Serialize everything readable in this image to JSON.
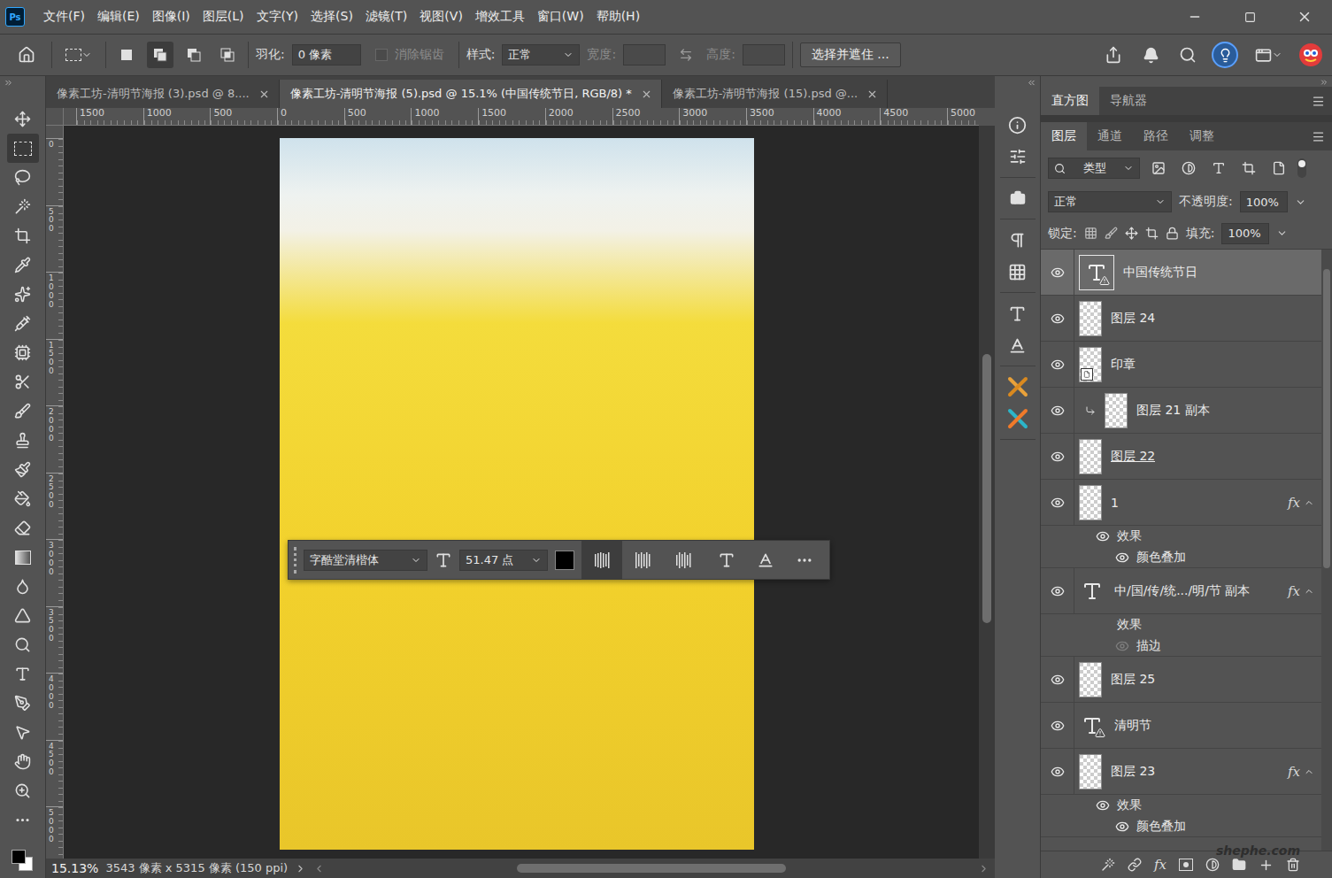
{
  "app": {
    "logo": "Ps"
  },
  "menu": [
    "文件(F)",
    "编辑(E)",
    "图像(I)",
    "图层(L)",
    "文字(Y)",
    "选择(S)",
    "滤镜(T)",
    "视图(V)",
    "增效工具",
    "窗口(W)",
    "帮助(H)"
  ],
  "options_bar": {
    "selection_modes": [
      {
        "selected": false
      },
      {
        "selected": true
      },
      {
        "selected": false
      },
      {
        "selected": false
      }
    ],
    "feather": {
      "label": "羽化:",
      "value": "0 像素"
    },
    "antialias": {
      "label": "消除锯齿",
      "checked": false,
      "disabled": true
    },
    "style": {
      "label": "样式:",
      "value": "正常"
    },
    "width": {
      "label": "宽度:",
      "value": "",
      "disabled": true
    },
    "height": {
      "label": "高度:",
      "value": "",
      "disabled": true
    },
    "mask_button": "选择并遮住 ..."
  },
  "tools": [
    {
      "selected": false
    },
    {
      "selected": true
    },
    {
      "selected": false
    },
    {
      "selected": false
    },
    {
      "selected": false
    },
    {
      "selected": false
    },
    {
      "selected": false
    },
    {
      "selected": false
    },
    {
      "selected": false
    },
    {
      "selected": false
    },
    {
      "selected": false
    },
    {
      "selected": false
    },
    {
      "selected": false
    },
    {
      "selected": false
    },
    {
      "selected": false
    },
    {
      "selected": false
    },
    {
      "selected": false
    },
    {
      "selected": false
    },
    {
      "selected": false
    },
    {
      "selected": false
    },
    {
      "selected": false
    },
    {
      "selected": false
    },
    {
      "selected": false
    },
    {
      "selected": false
    },
    {
      "selected": false
    }
  ],
  "doc_tabs": [
    {
      "label": "像素工坊-清明节海报 (3).psd @ 8....",
      "selected": false
    },
    {
      "label": "像素工坊-清明节海报 (5).psd @ 15.1% (中国传统节日, RGB/8) *",
      "selected": true
    },
    {
      "label": "像素工坊-清明节海报 (15).psd @...",
      "selected": false
    }
  ],
  "rulers": {
    "horizontal": [
      "1500",
      "1000",
      "500",
      "0",
      "500",
      "1000",
      "1500",
      "2000",
      "2500",
      "3000",
      "3500",
      "4000",
      "4500",
      "5000"
    ],
    "vertical": [
      "0",
      "500",
      "1000",
      "1500",
      "2000",
      "2500",
      "3000",
      "3500",
      "4000",
      "4500",
      "5000"
    ]
  },
  "text_toolbar": {
    "font": "字酷堂清楷体",
    "size": "51.47 点",
    "color": "#000000",
    "alignment": [
      {
        "selected": true
      },
      {
        "selected": false
      },
      {
        "selected": false
      }
    ]
  },
  "scroll": {
    "vertical": {
      "offset": 0.31,
      "size": 0.37
    },
    "horizontal": {
      "offset": 0.29,
      "size": 0.42
    }
  },
  "status_bar": {
    "zoom": "15.13%",
    "info": "3543 像素 x 5315 像素 (150 ppi)"
  },
  "panel_tabs": [
    {
      "label": "直方图",
      "selected": true
    },
    {
      "label": "导航器",
      "selected": false
    }
  ],
  "layer_tabs": [
    {
      "label": "图层",
      "selected": true
    },
    {
      "label": "通道",
      "selected": false
    },
    {
      "label": "路径",
      "selected": false
    },
    {
      "label": "调整",
      "selected": false
    }
  ],
  "layers_panel": {
    "filter": "类型",
    "blend_mode": "正常",
    "opacity_label": "不透明度:",
    "opacity": "100%",
    "lock_label": "锁定:",
    "fill_label": "填充:",
    "fill": "100%",
    "footer_fx": "fx",
    "scroll": {
      "offset": 0.03,
      "size": 0.5
    },
    "layers": [
      {
        "name": "中国传统节日",
        "kind": "text",
        "framed": true,
        "warning": true,
        "visible": true,
        "selected": true,
        "clipped": false,
        "underlined": false,
        "fx": null,
        "effects": null
      },
      {
        "name": "图层 24",
        "kind": "pixel",
        "framed": true,
        "warning": false,
        "visible": true,
        "selected": false,
        "clipped": false,
        "underlined": false,
        "fx": null,
        "effects": null
      },
      {
        "name": "印章",
        "kind": "smart",
        "framed": true,
        "warning": false,
        "visible": true,
        "selected": false,
        "clipped": false,
        "underlined": false,
        "fx": null,
        "effects": null
      },
      {
        "name": "图层 21 副本",
        "kind": "pixel",
        "framed": true,
        "warning": false,
        "visible": true,
        "selected": false,
        "clipped": true,
        "underlined": false,
        "fx": null,
        "effects": null
      },
      {
        "name": "图层 22",
        "kind": "pixel",
        "framed": true,
        "warning": false,
        "visible": true,
        "selected": false,
        "clipped": false,
        "underlined": true,
        "fx": null,
        "effects": null
      },
      {
        "name": "1",
        "kind": "pixel",
        "framed": true,
        "warning": false,
        "visible": true,
        "selected": false,
        "clipped": false,
        "underlined": false,
        "fx": "fx",
        "effects": {
          "label": "效果",
          "visible": true,
          "items": [
            {
              "name": "颜色叠加",
              "visible": true
            }
          ]
        }
      },
      {
        "name": "中/国/传/统.../明/节 副本",
        "kind": "text",
        "framed": false,
        "warning": false,
        "visible": true,
        "selected": false,
        "clipped": false,
        "underlined": false,
        "fx": "fx",
        "effects": {
          "label": "效果",
          "visible": false,
          "items": [
            {
              "name": "描边",
              "visible": false
            }
          ]
        }
      },
      {
        "name": "图层 25",
        "kind": "pixel",
        "framed": true,
        "warning": false,
        "visible": true,
        "selected": false,
        "clipped": false,
        "underlined": false,
        "fx": null,
        "effects": null
      },
      {
        "name": "清明节",
        "kind": "text",
        "framed": false,
        "warning": true,
        "visible": true,
        "selected": false,
        "clipped": false,
        "underlined": false,
        "fx": null,
        "effects": null
      },
      {
        "name": "图层 23",
        "kind": "pixel",
        "framed": true,
        "warning": false,
        "visible": true,
        "selected": false,
        "clipped": false,
        "underlined": false,
        "fx": "fx",
        "effects": {
          "label": "效果",
          "visible": true,
          "items": [
            {
              "name": "颜色叠加",
              "visible": true
            }
          ]
        }
      }
    ]
  },
  "watermark": "shephe.com"
}
